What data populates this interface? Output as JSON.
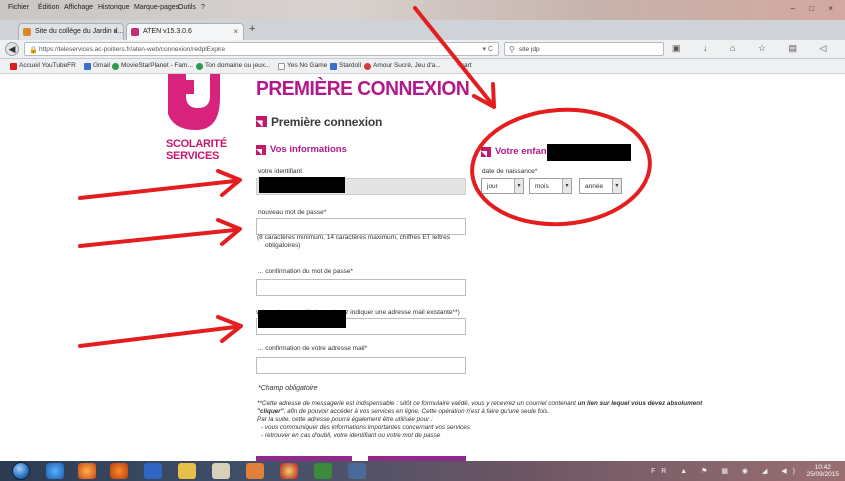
{
  "browser": {
    "menu": [
      "Fichier",
      "Édition",
      "Affichage",
      "Historique",
      "Marque-pages",
      "Outils",
      "?"
    ],
    "tabs": [
      {
        "label": "Site du collège du Jardin d...",
        "close": "×"
      },
      {
        "label": "ATEN v15.3.0.6",
        "close": "×"
      }
    ],
    "new_tab": "+",
    "url": "https://teleservices.ac-poitiers.fr/aten-web/connexion/redplExpire",
    "search_value": "site jdp",
    "bookmarks": [
      "Accueil YouTubeFR",
      "Gmail",
      "MovieStarPlanet - Fam...",
      "Ton domaine ou jeux...",
      "Yes No Game",
      "Stardoll",
      "Amour Sucré, Jeu d'a...",
      "+cart"
    ],
    "window_buttons": "– □ ×"
  },
  "logo": {
    "line1": "SCOLARITÉ",
    "line2": "SERVICES"
  },
  "page": {
    "title": "PREMIÈRE CONNEXION",
    "section_title": "Première connexion",
    "vos_infos": {
      "heading": "Vos informations",
      "identifiant_label": "votre identifiant",
      "password_label": "nouveau mot de passe*",
      "password_note_line1": "(8 caractères minimum, 14 caractères maximum, chiffres ET lettres",
      "password_note_line2": "obligatoires)",
      "confirm_password_label": "... confirmation du mot de passe*",
      "email_label": "votre adresse mail* (vous devez indiquer une adresse mail existante**)",
      "confirm_email_label": "... confirmation de votre adresse mail*"
    },
    "enfant": {
      "heading": "Votre enfant:",
      "birth_label": "date de naissance*",
      "day": "jour",
      "month": "mois",
      "year": "année"
    },
    "required_note": "*Champ obligatoire",
    "footnote": {
      "p1_start": "**Cette adresse de messagerie est indispensable : sitôt ce formulaire validé, vous y recevrez un courriel contenant ",
      "p1_bold": "un lien sur lequel vous devez absolument \"cliquer\"",
      "p1_end": ", afin de pouvoir accéder à vos services en ligne. Cette opération n'est à faire qu'une seule fois.",
      "p2": "Par la suite, cette adresse pourra également être utilisée pour :",
      "b1": "- vous communiquer des informations importantes concernant vos services",
      "b2": "- retrouver en cas d'oubli, votre identifiant ou votre mot de passe"
    }
  },
  "taskbar": {
    "clock_time": "10:42",
    "clock_date": "25/09/2015",
    "tray": "FR ▲ ⚑ ▦ ◉ ◢ ◀)"
  },
  "colors": {
    "brand_magenta": "#b4198a",
    "logo_pink": "#c3186c",
    "annotation_red": "#e41e1e"
  }
}
